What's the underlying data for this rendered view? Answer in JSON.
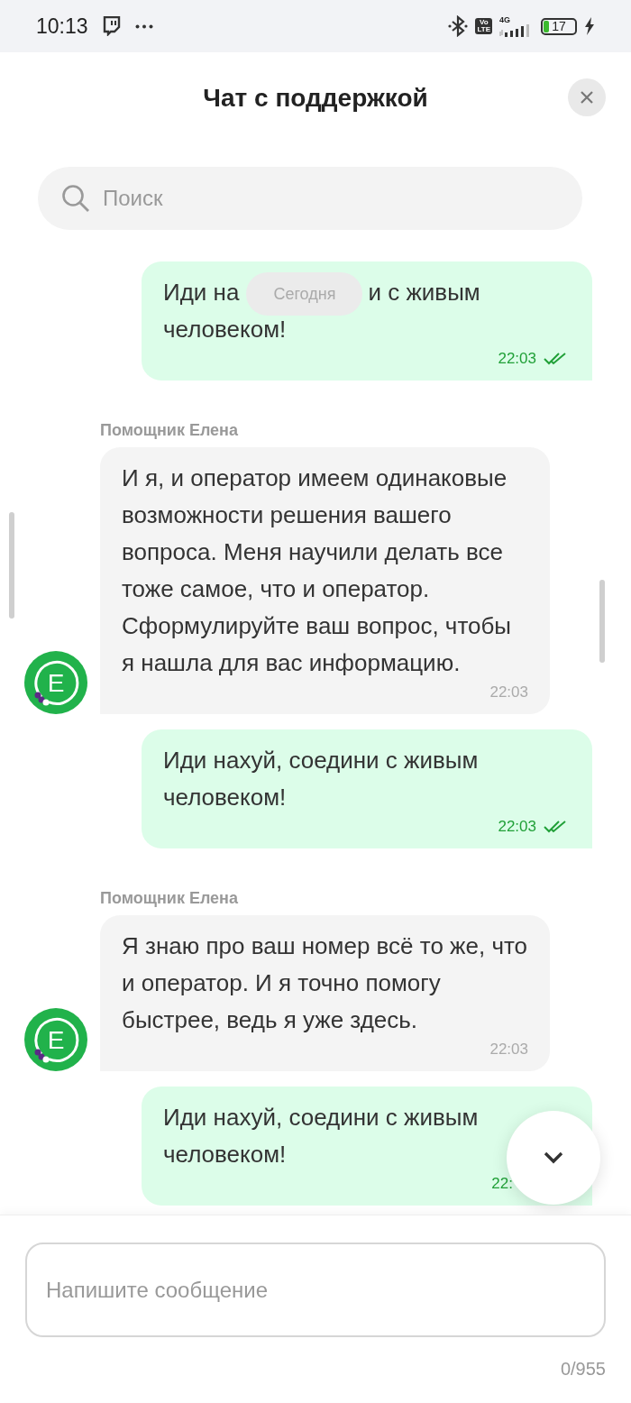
{
  "status_bar": {
    "time": "10:13",
    "volte": [
      "Vo",
      "LTE"
    ],
    "network": "4G",
    "battery": {
      "text": "17",
      "level": 0.17,
      "charging": true
    }
  },
  "header": {
    "title": "Чат с поддержкой"
  },
  "search": {
    "placeholder": "Поиск"
  },
  "date_chip": "Сегодня",
  "messages": [
    {
      "kind": "outgoing",
      "visible_parts": [
        "Иди на",
        "и с живым",
        "человеком!"
      ],
      "time": "22:03",
      "read": true
    },
    {
      "kind": "incoming",
      "sender": "Помощник Елена",
      "avatar": "E",
      "text": "И я, и оператор имеем одинаковые возможности решения вашего вопроса. Меня научили делать все тоже самое, что и оператор. Сформулируйте ваш вопрос, чтобы я нашла для вас информацию.",
      "time": "22:03"
    },
    {
      "kind": "outgoing",
      "text": "Иди нахуй, соедини с живым человеком!",
      "time": "22:03",
      "read": true
    },
    {
      "kind": "incoming",
      "sender": "Помощник Елена",
      "avatar": "E",
      "text": "Я знаю про ваш номер всё то же, что и оператор. И я точно помогу быстрее, ведь я уже здесь.",
      "time": "22:03"
    },
    {
      "kind": "outgoing",
      "text": "Иди нахуй, соедини с живым человеком!",
      "time": "22:"
    }
  ],
  "composer": {
    "placeholder": "Напишите сообщение",
    "counter": "0/955"
  }
}
